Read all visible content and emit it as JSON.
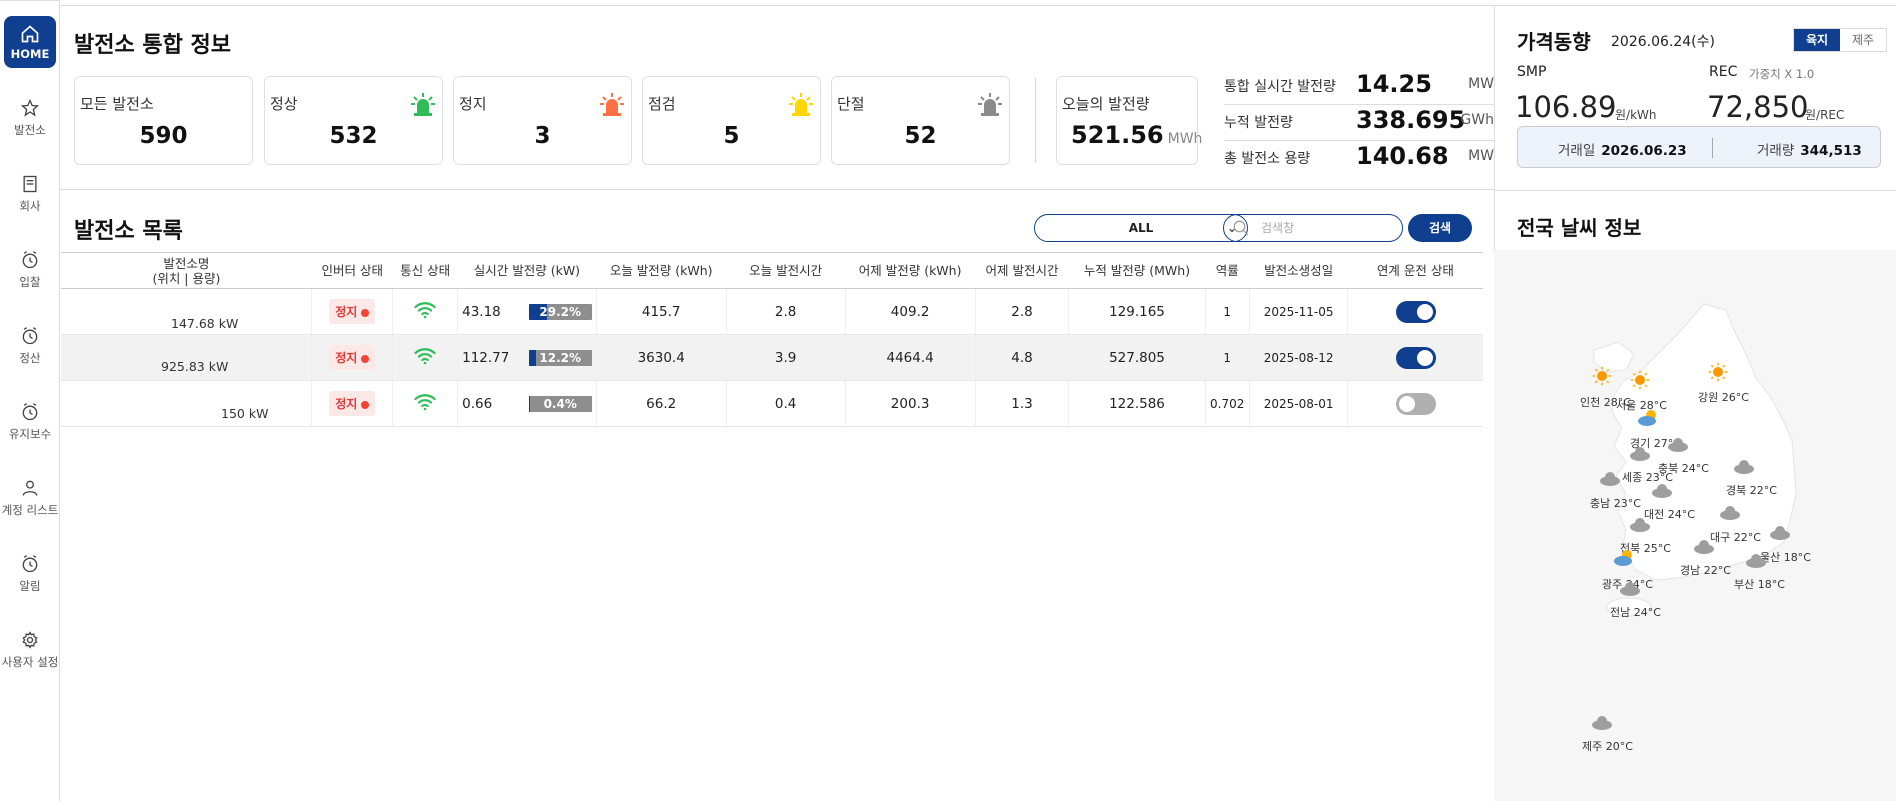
{
  "sidebar": {
    "items": [
      {
        "label": "HOME",
        "icon": "home-icon"
      },
      {
        "label": "발전소",
        "icon": "star-icon"
      },
      {
        "label": "회사",
        "icon": "building-icon"
      },
      {
        "label": "입찰",
        "icon": "clock-icon"
      },
      {
        "label": "정산",
        "icon": "clock-icon"
      },
      {
        "label": "유지보수",
        "icon": "clock-icon"
      },
      {
        "label": "계정 리스트",
        "icon": "user-icon"
      },
      {
        "label": "알림",
        "icon": "clock-icon"
      },
      {
        "label": "사용자 설정",
        "icon": "gear-icon"
      }
    ]
  },
  "summary": {
    "title": "발전소 통합 정보",
    "cards": [
      {
        "label": "모든 발전소",
        "value": "590"
      },
      {
        "label": "정상",
        "value": "532",
        "color": "#2ebd59"
      },
      {
        "label": "정지",
        "value": "3",
        "color": "#ff7043"
      },
      {
        "label": "점검",
        "value": "5",
        "color": "#ffd600"
      },
      {
        "label": "단절",
        "value": "52",
        "color": "#8a8a8a"
      }
    ],
    "today": {
      "label": "오늘의 발전량",
      "value": "521.56",
      "unit": "MWh"
    },
    "stats": [
      {
        "label": "통합 실시간 발전량",
        "value": "14.25",
        "unit": "MW"
      },
      {
        "label": "누적 발전량",
        "value": "338.695",
        "unit": "GWh"
      },
      {
        "label": "총 발전소 용량",
        "value": "140.68",
        "unit": "MW"
      }
    ]
  },
  "list": {
    "title": "발전소 목록",
    "filter_value": "ALL",
    "search_placeholder": "검색창",
    "search_button": "검색",
    "headers": {
      "name": "발전소명",
      "name_sub": "(위치 | 용량)",
      "inverter": "인버터 상태",
      "comm": "통신 상태",
      "realtime": "실시간 발전량 (kW)",
      "today_gen": "오늘 발전량 (kWh)",
      "today_hours": "오늘 발전시간",
      "yesterday_gen": "어제 발전량 (kWh)",
      "yesterday_hours": "어제 발전시간",
      "cumulative": "누적 발전량 (MWh)",
      "efficiency": "역률",
      "created": "발전소생성일",
      "link": "연계 운전 상태"
    },
    "rows": [
      {
        "capacity": "147.68 kW",
        "inverter": "정지",
        "realtime": "43.18",
        "pct": "29.2%",
        "pct_value": 29.2,
        "today_gen": "415.7",
        "today_hours": "2.8",
        "yesterday_gen": "409.2",
        "yesterday_hours": "2.8",
        "cumulative": "129.165",
        "efficiency": "1",
        "created": "2025-11-05",
        "link_on": true
      },
      {
        "capacity": "925.83 kW",
        "inverter": "정지",
        "realtime": "112.77",
        "pct": "12.2%",
        "pct_value": 12.2,
        "today_gen": "3630.4",
        "today_hours": "3.9",
        "yesterday_gen": "4464.4",
        "yesterday_hours": "4.8",
        "cumulative": "527.805",
        "efficiency": "1",
        "created": "2025-08-12",
        "link_on": true
      },
      {
        "capacity": "150 kW",
        "inverter": "정지",
        "realtime": "0.66",
        "pct": "0.4%",
        "pct_value": 0.4,
        "today_gen": "66.2",
        "today_hours": "0.4",
        "yesterday_gen": "200.3",
        "yesterday_hours": "1.3",
        "cumulative": "122.586",
        "efficiency": "0.702",
        "created": "2025-08-01",
        "link_on": false
      }
    ]
  },
  "price": {
    "title": "가격동향",
    "date": "2026.06.24(수)",
    "tabs": [
      "육지",
      "제주"
    ],
    "smp_label": "SMP",
    "smp_value": "106.89",
    "smp_unit": "원/kWh",
    "rec_label": "REC",
    "rec_weight": "가중치 X 1.0",
    "rec_value": "72,850",
    "rec_unit": "원/REC",
    "trade_date_label": "거래일",
    "trade_date": "2026.06.23",
    "trade_volume_label": "거래량",
    "trade_volume": "344,513"
  },
  "weather": {
    "title": "전국 날씨 정보",
    "regions": [
      {
        "label": "인천 28°C",
        "icon": "sun-icon"
      },
      {
        "label": "서울 28°C",
        "icon": "sun-icon"
      },
      {
        "label": "강원 26°C",
        "icon": "sun-icon"
      },
      {
        "label": "경기 27°C",
        "icon": "partly-cloudy-icon"
      },
      {
        "label": "충북 24°C",
        "icon": "cloud-icon"
      },
      {
        "label": "세종 23°C",
        "icon": "cloud-icon"
      },
      {
        "label": "경북 22°C",
        "icon": "cloud-icon"
      },
      {
        "label": "충남 23°C",
        "icon": "cloud-icon"
      },
      {
        "label": "대전 24°C",
        "icon": "cloud-icon"
      },
      {
        "label": "대구 22°C",
        "icon": "cloud-icon"
      },
      {
        "label": "전북 25°C",
        "icon": "cloud-icon"
      },
      {
        "label": "울산 18°C",
        "icon": "cloud-icon"
      },
      {
        "label": "경남 22°C",
        "icon": "cloud-icon"
      },
      {
        "label": "광주 24°C",
        "icon": "partly-cloudy-icon"
      },
      {
        "label": "부산 18°C",
        "icon": "cloud-icon"
      },
      {
        "label": "전남 24°C",
        "icon": "cloud-icon"
      },
      {
        "label": "제주 20°C",
        "icon": "cloud-icon"
      }
    ]
  },
  "colors": {
    "accent": "#0f3f8e",
    "stop": "#f44336",
    "wifi": "#2ebd59"
  }
}
